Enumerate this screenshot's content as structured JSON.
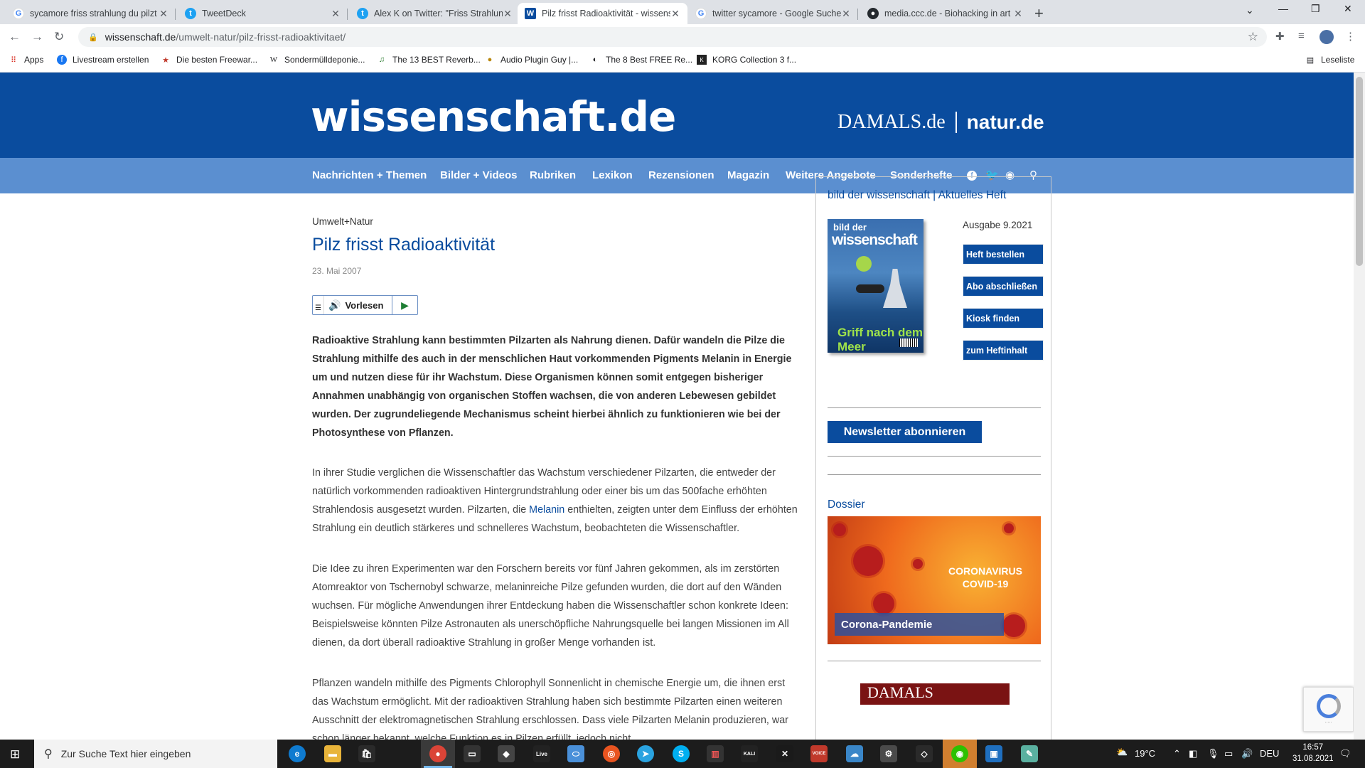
{
  "browser": {
    "tabs": [
      {
        "title": "sycamore friss strahlung du pilzt",
        "icon": "google-icon",
        "color": "#4285f4"
      },
      {
        "title": "TweetDeck",
        "icon": "twitter-icon",
        "color": "#1da1f2"
      },
      {
        "title": "Alex K on Twitter: \"Friss Strahlung",
        "icon": "twitter-icon",
        "color": "#1da1f2"
      },
      {
        "title": "Pilz frisst Radioaktivität - wissens",
        "icon": "wissenschaft-icon",
        "color": "#0a4c9e"
      },
      {
        "title": "twitter sycamore - Google Suche",
        "icon": "google-icon",
        "color": "#4285f4"
      },
      {
        "title": "media.ccc.de - Biohacking in art",
        "icon": "github-icon",
        "color": "#24292e"
      }
    ],
    "active_tab": 3,
    "url_domain": "wissenschaft.de",
    "url_path": "/umwelt-natur/pilz-frisst-radioaktivitaet/",
    "bookmarks": [
      {
        "label": "Apps",
        "icon": "apps-grid-icon"
      },
      {
        "label": "Livestream erstellen",
        "icon": "facebook-icon"
      },
      {
        "label": "Die besten Freewar...",
        "icon": "star-icon"
      },
      {
        "label": "Sondermülldeponie...",
        "icon": "wikipedia-icon"
      },
      {
        "label": "The 13 BEST Reverb...",
        "icon": "music-icon"
      },
      {
        "label": "Audio Plugin Guy |...",
        "icon": "plugin-icon"
      },
      {
        "label": "The 8 Best FREE Re...",
        "icon": "moon-icon"
      },
      {
        "label": "KORG Collection 3 f...",
        "icon": "korg-icon"
      }
    ],
    "reading_list": "Leseliste"
  },
  "site": {
    "logo": "wissenschaft.de",
    "partner1": "DAMALS.de",
    "partner2": "natur.de",
    "nav": [
      "Nachrichten + Themen",
      "Bilder + Videos",
      "Rubriken",
      "Lexikon",
      "Rezensionen",
      "Magazin",
      "Weitere Angebote",
      "Sonderhefte"
    ]
  },
  "article": {
    "category": "Umwelt+Natur",
    "title": "Pilz frisst Radioaktivität",
    "date": "23. Mai 2007",
    "tts_label": "Vorlesen",
    "lead": "Radioaktive Strahlung kann bestimmten Pilzarten als Nahrung dienen. Dafür wandeln die Pilze die Strahlung mithilfe des auch in der menschlichen Haut vorkommenden Pigments Melanin in Energie um und nutzen diese für ihr Wachstum. Diese Organismen können somit entgegen bisheriger Annahmen unabhängig von organischen Stoffen wachsen, die von anderen Lebewesen gebildet wurden. Der zugrundeliegende Mechanismus scheint hierbei ähnlich zu funktionieren wie bei der Photosynthese von Pflanzen.",
    "p2_a": "In ihrer Studie verglichen die Wissenschaftler das Wachstum verschiedener Pilzarten, die entweder der natürlich vorkommenden radioaktiven Hintergrundstrahlung oder einer bis um das 500fache erhöhten Strahlendosis ausgesetzt wurden. Pilzarten, die ",
    "p2_link": "Melanin",
    "p2_b": " enthielten, zeigten unter dem Einfluss der erhöhten Strahlung ein deutlich stärkeres und schnelleres Wachstum, beobachteten die Wissenschaftler.",
    "p3": "Die Idee zu ihren Experimenten war den Forschern bereits vor fünf Jahren gekommen, als im zerstörten Atomreaktor von Tschernobyl schwarze, melaninreiche Pilze gefunden wurden, die dort auf den Wänden wuchsen. Für mögliche Anwendungen ihrer Entdeckung haben die Wissenschaftler schon konkrete Ideen: Beispielsweise könnten Pilze Astronauten als unerschöpfliche Nahrungsquelle bei langen Missionen im All dienen, da dort überall radioaktive Strahlung in großer Menge vorhanden ist.",
    "p4": "Pflanzen wandeln mithilfe des Pigments Chlorophyll Sonnenlicht in chemische Energie um, die ihnen erst das Wachstum ermöglicht. Mit der radioaktiven Strahlung haben sich bestimmte Pilzarten einen weiteren Ausschnitt der elektromagnetischen Strahlung erschlossen. Dass viele Pilzarten Melanin produzieren, war schon länger bekannt, welche Funktion es in Pilzen erfüllt, jedoch nicht."
  },
  "sidebar": {
    "title": "bild der wissenschaft | Aktuelles Heft",
    "cover_line1": "bild der",
    "cover_line2": "wissenschaft",
    "cover_headline": "Griff nach dem Meer",
    "issue": "Ausgabe 9.2021",
    "buttons": [
      "Heft bestellen",
      "Abo abschließen",
      "Kiosk finden",
      "zum Heftinhalt"
    ],
    "newsletter": "Newsletter abonnieren",
    "dossier": "Dossier",
    "corona_text": "CORONAVIRUS COVID-19",
    "corona_caption": "Corona-Pandemie",
    "damals_thumb": "DAMALS"
  },
  "taskbar": {
    "search_placeholder": "Zur Suche Text hier eingeben",
    "weather": "19°C",
    "lang": "DEU",
    "time": "16:57",
    "date": "31.08.2021"
  }
}
